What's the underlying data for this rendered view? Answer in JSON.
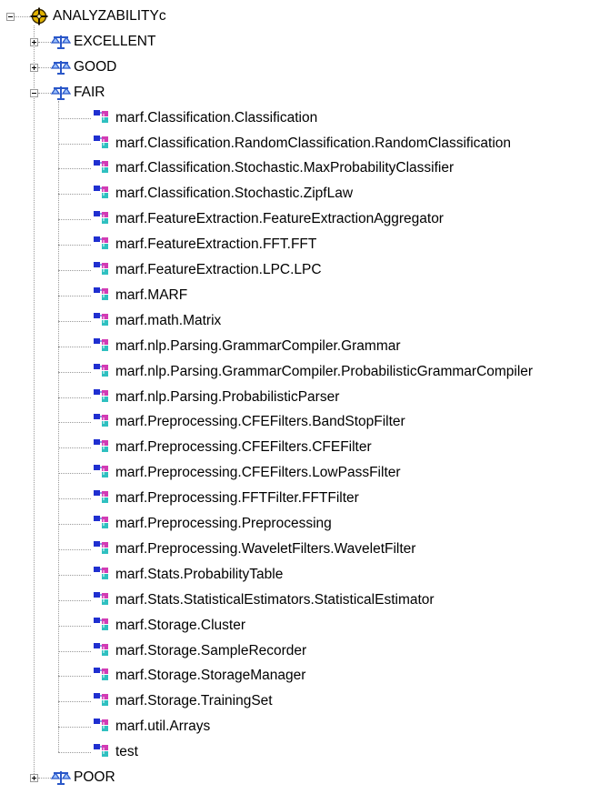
{
  "root": {
    "label": "ANALYZABILITYc",
    "icon": "target-crosshair-icon"
  },
  "categories": [
    {
      "label": "EXCELLENT",
      "expanded": false
    },
    {
      "label": "GOOD",
      "expanded": false
    },
    {
      "label": "FAIR",
      "expanded": true
    },
    {
      "label": "POOR",
      "expanded": false
    }
  ],
  "fair_items": [
    "marf.Classification.Classification",
    "marf.Classification.RandomClassification.RandomClassification",
    "marf.Classification.Stochastic.MaxProbabilityClassifier",
    "marf.Classification.Stochastic.ZipfLaw",
    "marf.FeatureExtraction.FeatureExtractionAggregator",
    "marf.FeatureExtraction.FFT.FFT",
    "marf.FeatureExtraction.LPC.LPC",
    "marf.MARF",
    "marf.math.Matrix",
    "marf.nlp.Parsing.GrammarCompiler.Grammar",
    "marf.nlp.Parsing.GrammarCompiler.ProbabilisticGrammarCompiler",
    "marf.nlp.Parsing.ProbabilisticParser",
    "marf.Preprocessing.CFEFilters.BandStopFilter",
    "marf.Preprocessing.CFEFilters.CFEFilter",
    "marf.Preprocessing.CFEFilters.LowPassFilter",
    "marf.Preprocessing.FFTFilter.FFTFilter",
    "marf.Preprocessing.Preprocessing",
    "marf.Preprocessing.WaveletFilters.WaveletFilter",
    "marf.Stats.ProbabilityTable",
    "marf.Stats.StatisticalEstimators.StatisticalEstimator",
    "marf.Storage.Cluster",
    "marf.Storage.SampleRecorder",
    "marf.Storage.StorageManager",
    "marf.Storage.TrainingSet",
    "marf.util.Arrays",
    "test"
  ],
  "icons": {
    "category": "balance-scale-icon",
    "item": "class-node-icon"
  },
  "colors": {
    "guide": "#9a9a9a",
    "scale": "#2a57c8",
    "class_a": "#1f2fd0",
    "class_b": "#d23bb4",
    "class_c": "#2fc0c0"
  }
}
